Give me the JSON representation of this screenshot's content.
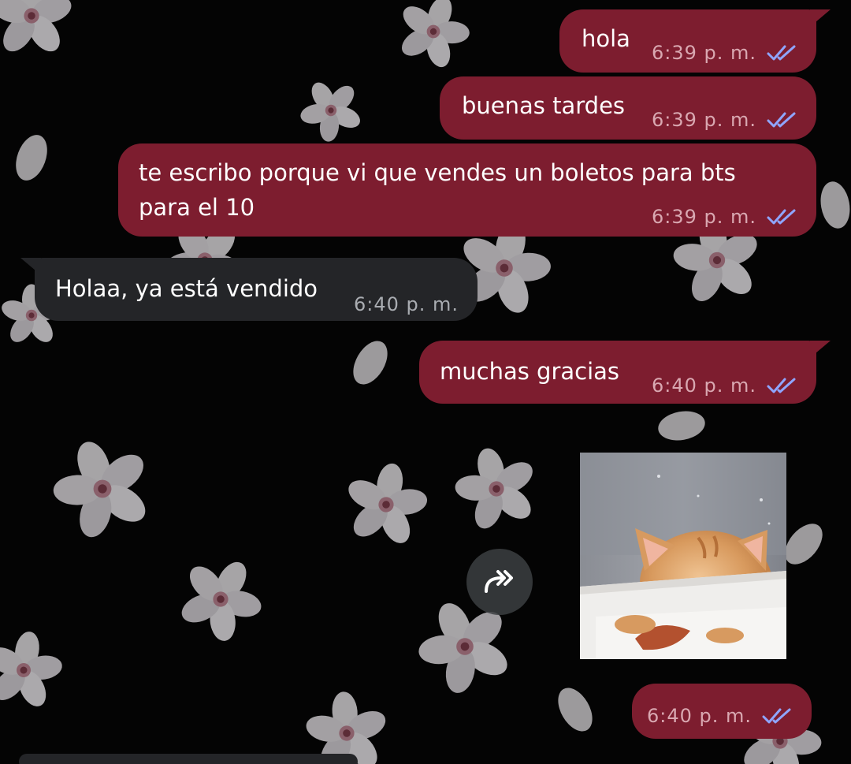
{
  "theme": {
    "outgoing_bubble": "#7d1d2f",
    "incoming_bubble": "#242528",
    "read_ticks": "#8fa5ff"
  },
  "messages": [
    {
      "id": "m1",
      "direction": "outgoing",
      "text": "hola",
      "time": "6:39 p. m.",
      "status": "read"
    },
    {
      "id": "m2",
      "direction": "outgoing",
      "text": "buenas tardes",
      "time": "6:39 p. m.",
      "status": "read"
    },
    {
      "id": "m3",
      "direction": "outgoing",
      "text_lines": [
        "te escribo porque vi que vendes un boletos para bts",
        "para el 10"
      ],
      "time": "6:39 p. m.",
      "status": "read"
    },
    {
      "id": "m4",
      "direction": "incoming",
      "text": "Holaa, ya está vendido",
      "time": "6:40 p. m."
    },
    {
      "id": "m5",
      "direction": "outgoing",
      "text": "muchas gracias",
      "time": "6:40 p. m.",
      "status": "read"
    },
    {
      "id": "m6",
      "direction": "outgoing",
      "type": "sticker",
      "sticker": "sad-kitten-sticker"
    },
    {
      "id": "m7",
      "direction": "outgoing",
      "text": "",
      "time": "6:40 p. m.",
      "status": "read"
    }
  ],
  "icons": {
    "read": "double-check-icon",
    "forward": "forward-icon"
  }
}
